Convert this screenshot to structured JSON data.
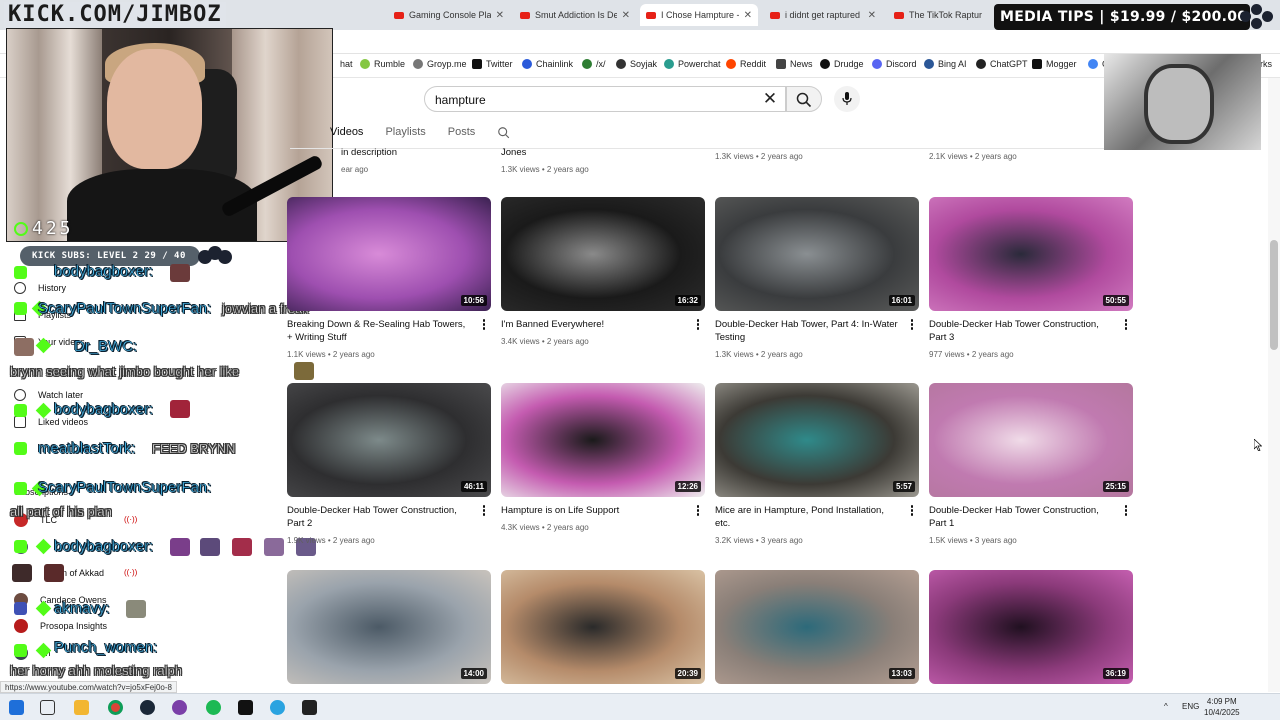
{
  "browser": {
    "tabs": [
      {
        "title": "Gaming Console Playi",
        "active": false
      },
      {
        "title": "Smut Addiction Is Des",
        "active": false
      },
      {
        "title": "I Chose Hampture - Yo",
        "active": true
      },
      {
        "title": "i didnt get raptured",
        "active": false
      },
      {
        "title": "The TikTok Rapture",
        "active": false
      }
    ],
    "bookmarks": [
      "hat",
      "Rumble",
      "Groyp.me",
      "Twitter",
      "Chainlink",
      "/x/",
      "Soyjak",
      "Powerchat",
      "Reddit",
      "News",
      "Drudge",
      "Discord",
      "Bing AI",
      "ChatGPT",
      "Mogger",
      "G",
      "rks"
    ],
    "status_url": "https://www.youtube.com/watch?v=jo5xFej0o-8"
  },
  "overlay": {
    "site_title": "KICK.COM/JIMBOZ",
    "media_tips": "MEDIA TIPS | $19.99 / $200.00",
    "viewer_count": "425",
    "kick_subs": "KICK SUBS: LEVEL 2 29 / 40"
  },
  "chat": [
    {
      "user": "bodybagboxer:",
      "text": ""
    },
    {
      "user": "ScaryPaulTownSuperFan:",
      "text": "jowvian a freak"
    },
    {
      "user": "Dr_BWC:",
      "text": "brynn seeing what jimbo bought her like"
    },
    {
      "user": "bodybagboxer:",
      "text": ""
    },
    {
      "user": "meatblastTork:",
      "text": "FEED BRYNN"
    },
    {
      "user": "ScaryPaulTownSuperFan:",
      "text": "all part of his plan"
    },
    {
      "user": "bodybagboxer:",
      "text": ""
    },
    {
      "user": "akmavy:",
      "text": ""
    },
    {
      "user": "Punch_women:",
      "text": "her horny ahh molesting ralph"
    }
  ],
  "sidebar": {
    "items": [
      "History",
      "Playlists",
      "Your videos",
      "Watch later",
      "Liked videos"
    ],
    "section": "Subscriptions",
    "subs": [
      "TLC",
      "V",
      "gon of Akkad",
      "Candace Owens",
      "Prosopa Insights",
      "Th"
    ]
  },
  "youtube": {
    "search": {
      "value": "hampture",
      "placeholder": "Search"
    },
    "channel_tabs": [
      "Videos",
      "Playlists",
      "Posts"
    ],
    "top_row": [
      {
        "title": "in description",
        "meta": "ear ago"
      },
      {
        "title": "Jones",
        "meta": "1.3K views • 2 years ago"
      },
      {
        "title": "",
        "meta": "1.3K views • 2 years ago"
      },
      {
        "title": "",
        "meta": "2.1K views • 2 years ago"
      }
    ],
    "videos": [
      {
        "title": "Breaking Down & Re-Sealing Hab Towers, + Writing Stuff",
        "meta": "1.1K views • 2 years ago",
        "duration": "10:56",
        "colors": [
          "#9e4fb0",
          "#d88bd8",
          "#3a2150"
        ]
      },
      {
        "title": "I'm Banned Everywhere!",
        "meta": "3.4K views • 2 years ago",
        "duration": "16:32",
        "colors": [
          "#1a1a1a",
          "#8a8a8a",
          "#2c2c2c"
        ]
      },
      {
        "title": "Double-Decker Hab Tower, Part 4: In-Water Testing",
        "meta": "1.3K views • 2 years ago",
        "duration": "16:01",
        "colors": [
          "#3a3c3e",
          "#8a8f92",
          "#5a5b5a"
        ]
      },
      {
        "title": "Double-Decker Hab Tower Construction, Part 3",
        "meta": "977 views • 2 years ago",
        "duration": "50:55",
        "colors": [
          "#b04a9e",
          "#2a2a3a",
          "#d17bc0"
        ]
      },
      {
        "title": "Double-Decker Hab Tower Construction, Part 2",
        "meta": "1.9K views • 2 years ago",
        "duration": "46:11",
        "colors": [
          "#2e2e30",
          "#7d8a8a",
          "#4a4a4c"
        ]
      },
      {
        "title": "Hampture is on Life Support",
        "meta": "4.3K views • 2 years ago",
        "duration": "12:26",
        "colors": [
          "#c45bb0",
          "#1a1a1a",
          "#eeeeee"
        ]
      },
      {
        "title": "Mice are in Hampture, Pond Installation, etc.",
        "meta": "3.2K views • 3 years ago",
        "duration": "5:57",
        "colors": [
          "#3c3a35",
          "#2f8a8a",
          "#9b9890"
        ]
      },
      {
        "title": "Double-Decker Hab Tower Construction, Part 1",
        "meta": "1.5K views • 3 years ago",
        "duration": "25:15",
        "colors": [
          "#c07ab0",
          "#f0dbe8",
          "#b4779e"
        ]
      },
      {
        "title": "",
        "meta": "",
        "duration": "14:00",
        "colors": [
          "#9aa3ac",
          "#4c5a66",
          "#c9c3bc"
        ]
      },
      {
        "title": "",
        "meta": "",
        "duration": "20:39",
        "colors": [
          "#b58b6a",
          "#2a2a2a",
          "#d9c2a4"
        ]
      },
      {
        "title": "",
        "meta": "",
        "duration": "13:03",
        "colors": [
          "#8a7f78",
          "#2d6a7a",
          "#b39e92"
        ]
      },
      {
        "title": "",
        "meta": "",
        "duration": "36:19",
        "colors": [
          "#8b3a7a",
          "#201020",
          "#c55fb0"
        ]
      }
    ]
  },
  "taskbar": {
    "lang": "ENG",
    "time": "4:09 PM",
    "date": "10/4/2025"
  },
  "colors": {
    "accent_red": "#e62117",
    "kick_green": "#53fc18",
    "chat_user": "#4ec9ff"
  }
}
